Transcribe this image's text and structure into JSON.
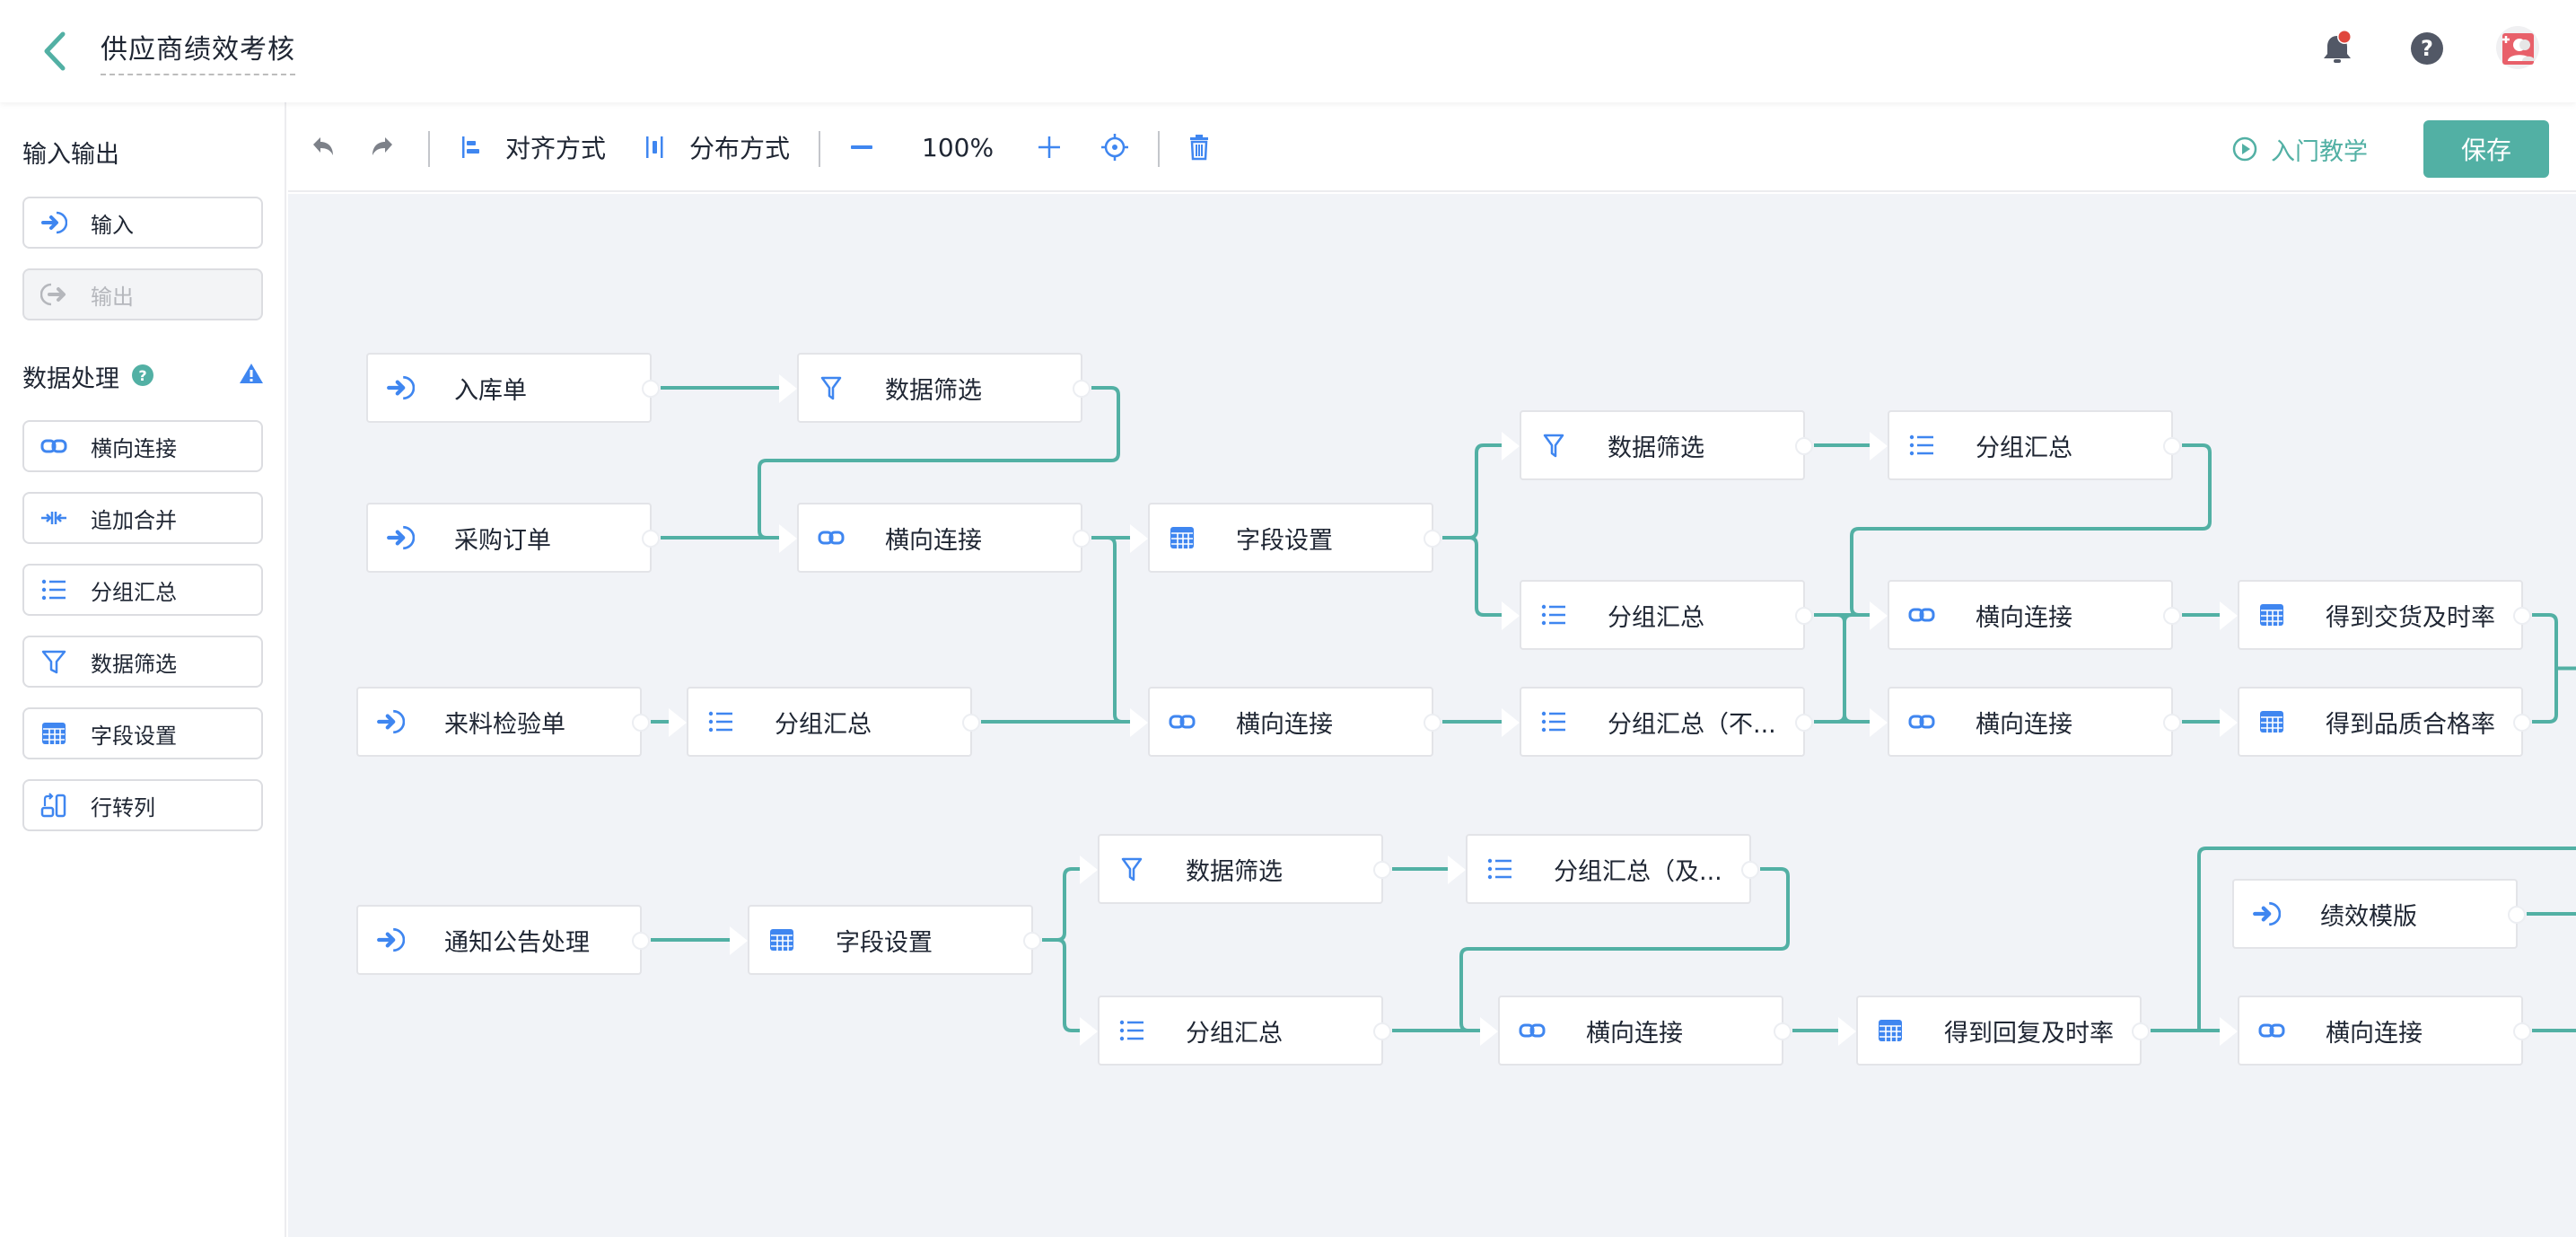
{
  "header": {
    "title": "供应商绩效考核",
    "back_icon": "chevron-left-icon",
    "icons": [
      "bell-icon",
      "help-icon",
      "user-avatar-icon"
    ],
    "notification_dot": true
  },
  "colors": {
    "accent": "#52b0a4",
    "icon_blue": "#3f86f0",
    "edge": "#52b0a4",
    "canvas_bg": "#f1f3f7",
    "notification": "#e0463c",
    "avatar": "#e8606a"
  },
  "toolbar": {
    "undo_icon": "undo-icon",
    "redo_icon": "redo-icon",
    "align_label": "对齐方式",
    "distribute_label": "分布方式",
    "zoom_level": "100%",
    "tutorial_label": "入门教学",
    "save_label": "保存"
  },
  "sidebar": {
    "io_title": "输入输出",
    "io_items": [
      {
        "label": "输入",
        "icon": "input-icon",
        "disabled": false
      },
      {
        "label": "输出",
        "icon": "output-icon",
        "disabled": true
      }
    ],
    "proc_title": "数据处理",
    "proc_items": [
      {
        "label": "横向连接",
        "icon": "link-icon"
      },
      {
        "label": "追加合并",
        "icon": "merge-icon"
      },
      {
        "label": "分组汇总",
        "icon": "list-icon"
      },
      {
        "label": "数据筛选",
        "icon": "filter-icon"
      },
      {
        "label": "字段设置",
        "icon": "table-icon"
      },
      {
        "label": "行转列",
        "icon": "pivot-icon"
      }
    ]
  },
  "nodes": [
    {
      "id": "n1",
      "label": "入库单",
      "type": "input"
    },
    {
      "id": "n2",
      "label": "数据筛选",
      "type": "filter"
    },
    {
      "id": "n3",
      "label": "采购订单",
      "type": "input"
    },
    {
      "id": "n4",
      "label": "横向连接",
      "type": "link"
    },
    {
      "id": "n5",
      "label": "字段设置",
      "type": "table"
    },
    {
      "id": "n6",
      "label": "数据筛选",
      "type": "filter"
    },
    {
      "id": "n7",
      "label": "分组汇总",
      "type": "list"
    },
    {
      "id": "n8",
      "label": "分组汇总",
      "type": "list"
    },
    {
      "id": "n9",
      "label": "横向连接",
      "type": "link"
    },
    {
      "id": "n10",
      "label": "得到交货及时率",
      "type": "table"
    },
    {
      "id": "n11",
      "label": "来料检验单",
      "type": "input"
    },
    {
      "id": "n12",
      "label": "分组汇总",
      "type": "list"
    },
    {
      "id": "n13",
      "label": "横向连接",
      "type": "link"
    },
    {
      "id": "n14",
      "label": "分组汇总（不...",
      "type": "list"
    },
    {
      "id": "n15",
      "label": "横向连接",
      "type": "link"
    },
    {
      "id": "n16",
      "label": "得到品质合格率",
      "type": "table"
    },
    {
      "id": "n17",
      "label": "通知公告处理",
      "type": "input"
    },
    {
      "id": "n18",
      "label": "字段设置",
      "type": "table"
    },
    {
      "id": "n19",
      "label": "数据筛选",
      "type": "filter"
    },
    {
      "id": "n20",
      "label": "分组汇总（及...",
      "type": "list"
    },
    {
      "id": "n21",
      "label": "分组汇总",
      "type": "list"
    },
    {
      "id": "n22",
      "label": "横向连接",
      "type": "link"
    },
    {
      "id": "n23",
      "label": "得到回复及时率",
      "type": "table"
    },
    {
      "id": "n24",
      "label": "绩效模版",
      "type": "input"
    },
    {
      "id": "n25",
      "label": "横向连接",
      "type": "link"
    }
  ],
  "edges": [
    [
      "n1",
      "n2"
    ],
    [
      "n3",
      "n4"
    ],
    [
      "n2",
      "n4"
    ],
    [
      "n4",
      "n5"
    ],
    [
      "n4",
      "n13"
    ],
    [
      "n5",
      "n6"
    ],
    [
      "n5",
      "n8"
    ],
    [
      "n6",
      "n7"
    ],
    [
      "n7",
      "n9"
    ],
    [
      "n8",
      "n9"
    ],
    [
      "n8",
      "n15"
    ],
    [
      "n9",
      "n10"
    ],
    [
      "n11",
      "n12"
    ],
    [
      "n12",
      "n13"
    ],
    [
      "n13",
      "n14"
    ],
    [
      "n14",
      "n15"
    ],
    [
      "n14",
      "n9"
    ],
    [
      "n15",
      "n16"
    ],
    [
      "n17",
      "n18"
    ],
    [
      "n18",
      "n19"
    ],
    [
      "n18",
      "n21"
    ],
    [
      "n19",
      "n20"
    ],
    [
      "n20",
      "n22"
    ],
    [
      "n21",
      "n22"
    ],
    [
      "n22",
      "n23"
    ],
    [
      "n23",
      "n25"
    ]
  ]
}
